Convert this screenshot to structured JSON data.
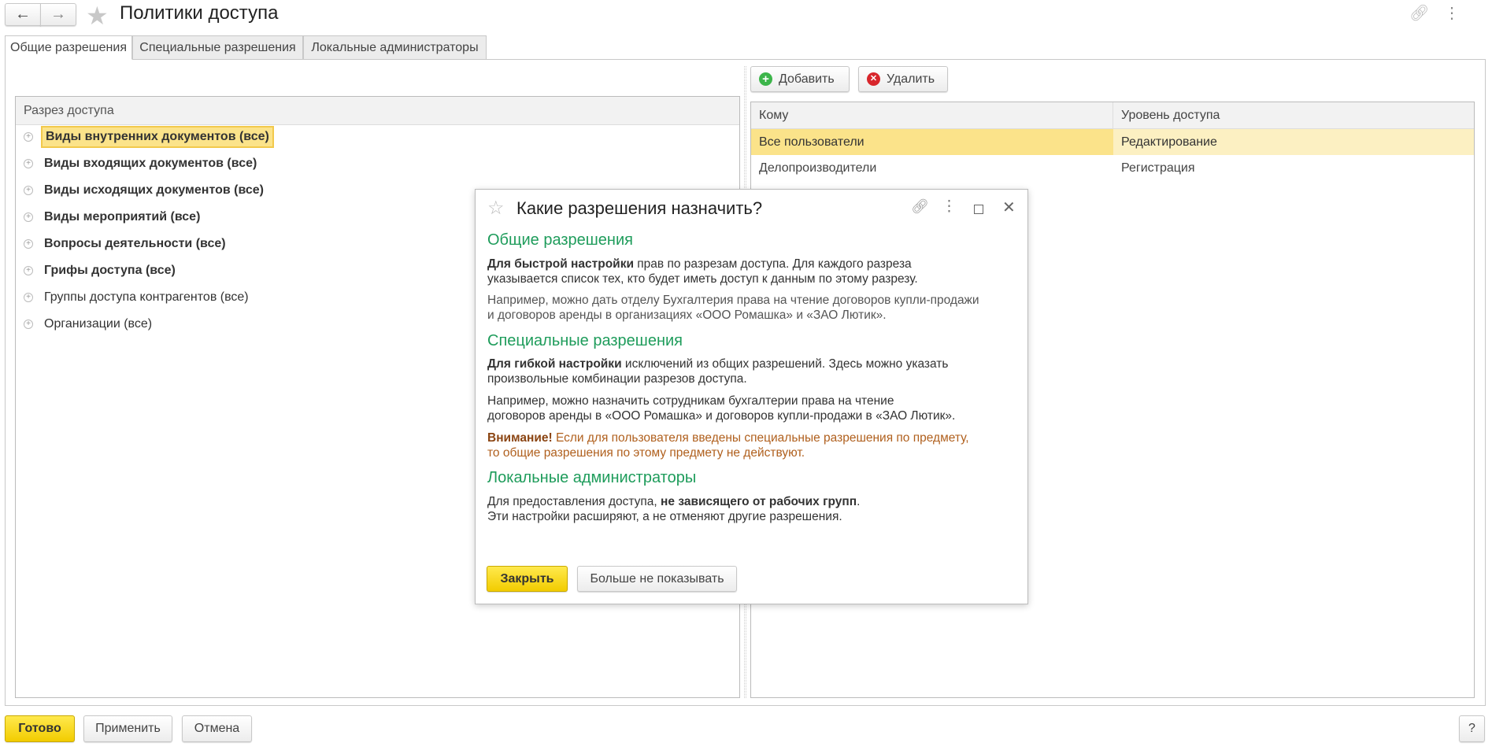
{
  "window": {
    "title": "Политики доступа",
    "back_icon": "arrow-left-icon",
    "forward_icon": "arrow-right-icon",
    "favorite_icon": "star-icon",
    "link_icon": "link-icon",
    "more_icon": "more-vertical-icon"
  },
  "tabs": [
    {
      "label": "Общие разрешения",
      "active": true
    },
    {
      "label": "Специальные разрешения",
      "active": false
    },
    {
      "label": "Локальные администраторы",
      "active": false
    }
  ],
  "left_table": {
    "header": "Разрез доступа",
    "rows": [
      {
        "label": "Виды внутренних документов (все)",
        "bold": true,
        "selected": true
      },
      {
        "label": "Виды входящих документов (все)",
        "bold": true
      },
      {
        "label": "Виды исходящих документов (все)",
        "bold": true
      },
      {
        "label": "Виды мероприятий (все)",
        "bold": true
      },
      {
        "label": "Вопросы деятельности (все)",
        "bold": true
      },
      {
        "label": "Грифы доступа (все)",
        "bold": true
      },
      {
        "label": "Группы доступа контрагентов (все)",
        "bold": false
      },
      {
        "label": "Организации (все)",
        "bold": false
      }
    ]
  },
  "right_toolbar": {
    "add": "Добавить",
    "delete": "Удалить"
  },
  "right_table": {
    "columns": [
      "Кому",
      "Уровень доступа"
    ],
    "rows": [
      [
        "Все пользователи",
        "Редактирование"
      ],
      [
        "Делопроизводители",
        "Регистрация"
      ]
    ]
  },
  "dialog": {
    "title": "Какие разрешения назначить?",
    "s1_title": "Общие разрешения",
    "s1_bold": "Для быстрой настройки",
    "s1_l1": " прав по разрезам доступа. Для каждого разреза",
    "s1_l2": "указывается список тех, кто будет иметь доступ к данным по этому разрезу.",
    "s1_ex1": "Например, можно дать отделу Бухгалтерия права на чтение договоров купли-продажи",
    "s1_ex2": "и договоров аренды в организациях «ООО Ромашка» и «ЗАО Лютик».",
    "s2_title": "Специальные разрешения",
    "s2_bold": "Для гибкой настройки",
    "s2_l1": " исключений из общих разрешений. Здесь можно указать",
    "s2_l2": "произвольные комбинации разрезов доступа.",
    "s2_ex1": "Например, можно назначить сотрудникам бухгалтерии права на чтение",
    "s2_ex2": "договоров аренды в «ООО Ромашка» и договоров купли-продажи в «ЗАО Лютик».",
    "warn_bold": "Внимание!",
    "warn_l1": " Если для пользователя введены специальные разрешения по предмету,",
    "warn_l2": "то общие разрешения по этому предмету не действуют.",
    "s3_title": "Локальные администраторы",
    "s3_l1": "Для предоставления доступа, ",
    "s3_bold": "не зависящего от рабочих групп",
    "s3_l1_end": ".",
    "s3_l2": "Эти настройки расширяют, а не отменяют другие разрешения.",
    "close_btn": "Закрыть",
    "dont_show_btn": "Больше не показывать"
  },
  "footer": {
    "done": "Готово",
    "apply": "Применить",
    "cancel": "Отмена",
    "help": "?"
  },
  "colors": {
    "accent_yellow": "#f2cc00",
    "selection": "#fbe38a",
    "heading_green": "#1e9c5b",
    "warning_brown": "#a0522d"
  }
}
